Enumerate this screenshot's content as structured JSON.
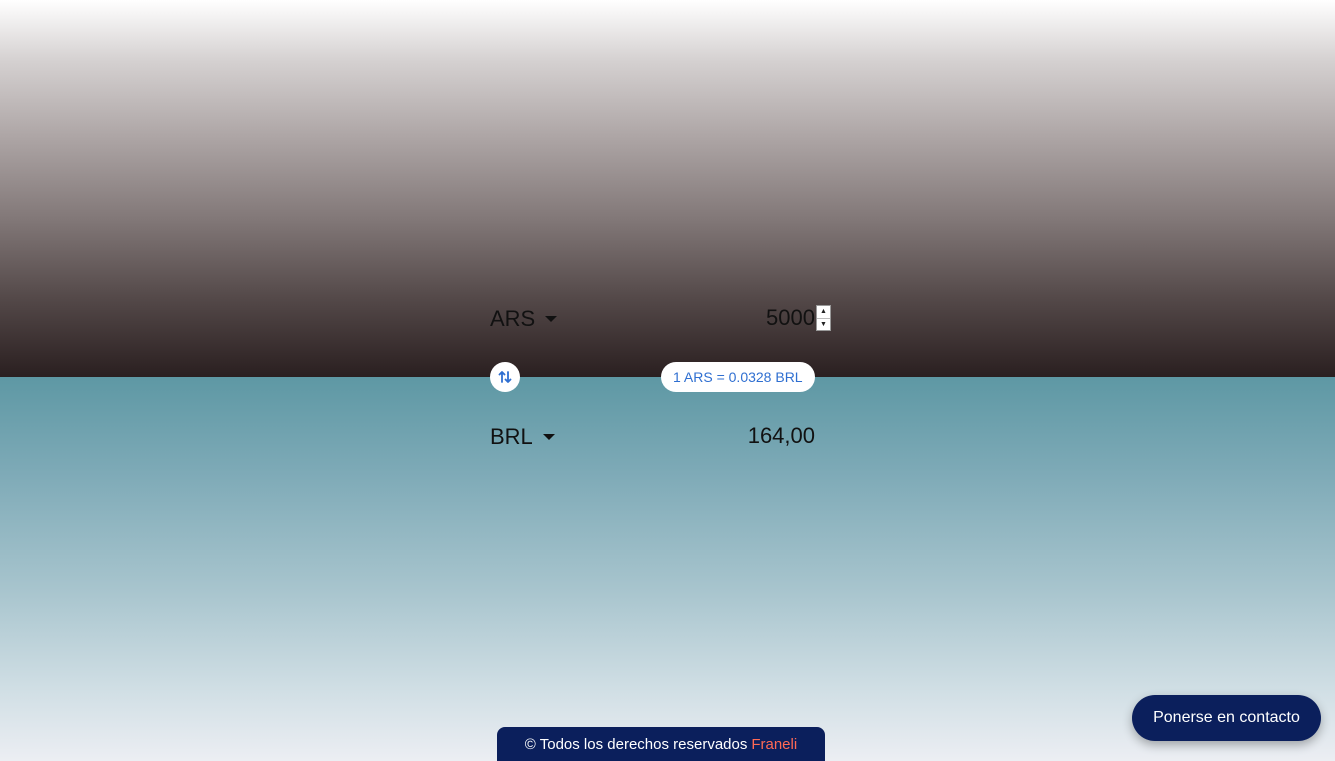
{
  "converter": {
    "from_currency": "ARS",
    "amount": "5000",
    "to_currency": "BRL",
    "result": "164,00",
    "rate_text": "1 ARS = 0.0328 BRL"
  },
  "footer": {
    "copyright": "© Todos los derechos reservados",
    "brand": "Franeli"
  },
  "contact_button": {
    "label": "Ponerse en contacto"
  },
  "colors": {
    "footer_bg": "#0b1f5c",
    "brand_accent": "#ff6a55",
    "rate_text": "#2f6fd1"
  },
  "icons": {
    "swap": "swap-vertical-arrows-icon",
    "dropdown": "caret-down-icon"
  }
}
